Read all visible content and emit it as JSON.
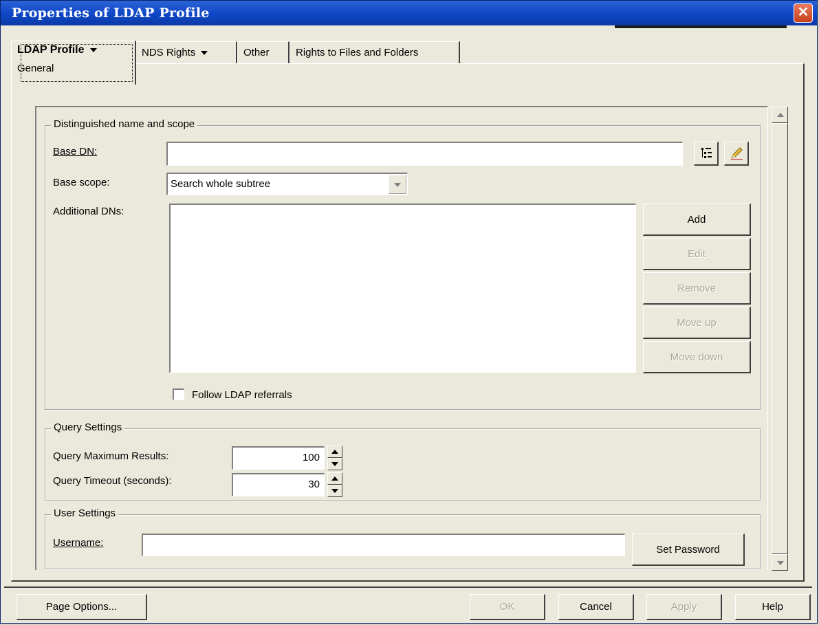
{
  "window": {
    "title": "Properties of LDAP Profile"
  },
  "tabs": [
    {
      "label": "LDAP Profile",
      "sublabel": "General",
      "active": true
    },
    {
      "label": "NDS Rights",
      "dropdown": true
    },
    {
      "label": "Other"
    },
    {
      "label": "Rights to Files and Folders"
    }
  ],
  "dn_group": {
    "legend": "Distinguished name and scope",
    "base_dn_label": "Base DN:",
    "base_dn_value": "",
    "base_scope_label": "Base scope:",
    "base_scope_value": "Search whole subtree",
    "additional_dns_label": "Additional DNs:",
    "buttons": {
      "add": "Add",
      "edit": "Edit",
      "remove": "Remove",
      "move_up": "Move up",
      "move_down": "Move down"
    },
    "follow_referrals_label": "Follow LDAP referrals",
    "follow_referrals_checked": false
  },
  "query_group": {
    "legend": "Query Settings",
    "max_results_label": "Query Maximum Results:",
    "max_results_value": "100",
    "timeout_label": "Query Timeout (seconds):",
    "timeout_value": "30"
  },
  "user_group": {
    "legend": "User Settings",
    "username_label": "Username:",
    "username_value": "",
    "set_password": "Set Password"
  },
  "footer": {
    "page_options": "Page Options...",
    "ok": "OK",
    "cancel": "Cancel",
    "apply": "Apply",
    "help": "Help"
  }
}
